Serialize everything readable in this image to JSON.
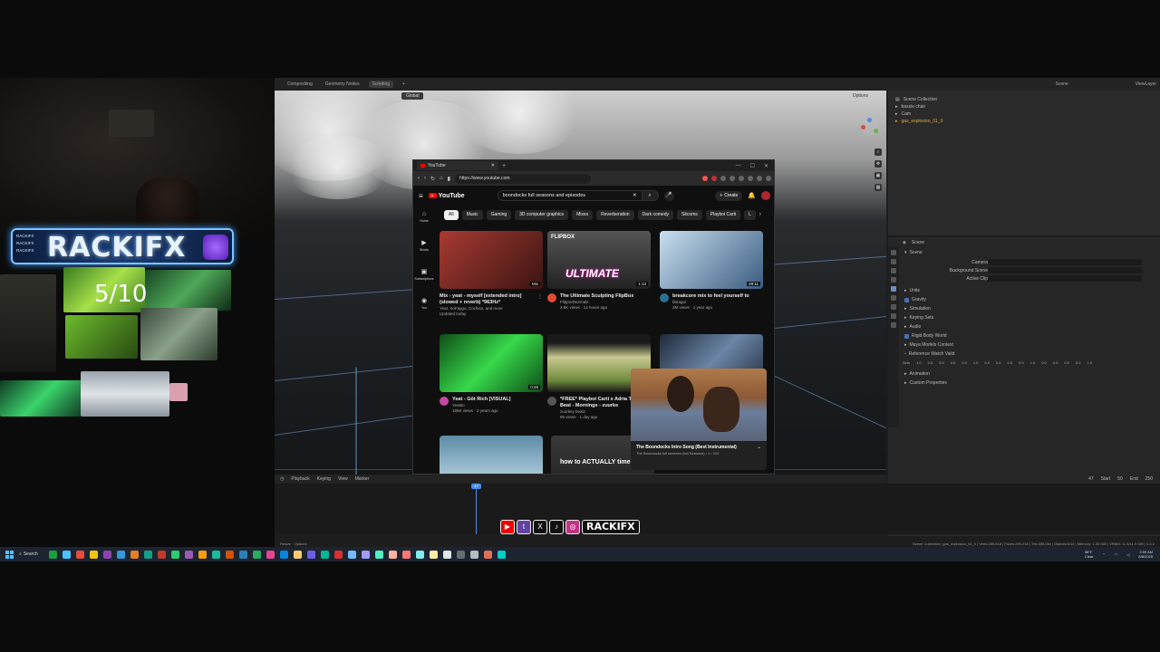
{
  "blender": {
    "workspace_tabs": [
      "Compositing",
      "Geometry Nodes",
      "Scripting",
      "+"
    ],
    "active_workspace": "Scripting",
    "viewport_mode": "Global",
    "options_label": "Options",
    "scene_label": "Scene",
    "view_layer_label": "ViewLayer",
    "outliner": {
      "rows": [
        "Scene Collection",
        "bassie chair",
        "Cam",
        "gas_explosion_01_0"
      ]
    },
    "properties": {
      "header": "Scene",
      "section_scene": "Scene",
      "fields": [
        {
          "label": "Camera"
        },
        {
          "label": "Background Scene"
        },
        {
          "label": "Active Clip"
        }
      ],
      "sections": [
        "Units",
        "Gravity",
        "Simulation",
        "Keying Sets",
        "Audio",
        "Rigid Body World",
        "Maya Models Context",
        "Reference Watch Valid",
        "Animation",
        "Custom Properties"
      ],
      "numbers": [
        "Sets",
        "1.0",
        "0.0",
        "0.0",
        "0.0",
        "0.0",
        "1.0",
        "0.0",
        "0.0",
        "0.0",
        "0.0",
        "1.0",
        "0.0",
        "0.0",
        "0.0",
        "0.0",
        "1.0"
      ]
    },
    "timeline": {
      "menu": [
        "Playback",
        "Keying",
        "View",
        "Marker"
      ],
      "current_frame": "47",
      "start_label": "Start",
      "start": "50",
      "end_label": "End",
      "end": "250"
    },
    "status_left": [
      "Resize",
      "Options"
    ],
    "status_right": "Scene Collection | gas_explosion_01_0 | Verts:285,518 | Faces:299,218 | Tris:555,06x | Objects:0/14 | Memory: 1.33 GiB | VRAM: 11.4/11.9 GiB | 4.3.2"
  },
  "browser": {
    "tab_title": "YouTube",
    "url": "https://www.youtube.com",
    "window_controls": [
      "—",
      "☐",
      "✕"
    ],
    "search_query": "boondocks full seasons and episodes",
    "create_label": "Create",
    "side_nav": [
      {
        "icon": "⌂",
        "label": "Home"
      },
      {
        "icon": "▶",
        "label": "Shorts"
      },
      {
        "icon": "▣",
        "label": "Subscriptions"
      },
      {
        "icon": "◉",
        "label": "You"
      }
    ],
    "chips": [
      "All",
      "Music",
      "Gaming",
      "3D computer graphics",
      "Mixes",
      "Reverberation",
      "Dark comedy",
      "Sitcoms",
      "Playboi Carti",
      "L"
    ],
    "videos": [
      {
        "title": "Mix - yeat - myself [extended intro] (slowed + reverb) *963Hz*",
        "meta1": "Yeat, SoFaygo, Cochise, and more",
        "meta2": "Updated today",
        "duration": "Mix",
        "thumb": "#6d2a26",
        "avatar": ""
      },
      {
        "title": "The Ultimate Sculpting FlipBox",
        "meta1": "FlippedNormals",
        "meta2": "2.8K views · 14 hours ago",
        "duration": "1:13",
        "thumb": "#3d3d3d",
        "avatar": "#e24a3a",
        "overlay": "ULTIMATE",
        "brand": "FLIPBOX"
      },
      {
        "title": "breakcore mix to feel yourself to",
        "meta1": "bbragui",
        "meta2": "2M views · 1 year ago",
        "duration": "29:11",
        "thumb": "#8fb4d6",
        "avatar": "#2a6f8f"
      },
      {
        "title": "Yeat - Gōt Rich [VISUAL]",
        "meta1": "Yeatito",
        "meta2": "185K views · 2 years ago",
        "duration": "0:28",
        "thumb": "#1d8a2a",
        "avatar": "#c44aa0"
      },
      {
        "title": "*FREE* Playboi Carti x Adria Type Beat - Mornings - zuurke",
        "meta1": "zuurkey beatz",
        "meta2": "96 views · 1 day ago",
        "duration": "",
        "thumb": "#7d8a55",
        "avatar": "#555555"
      },
      {
        "title": "",
        "meta1": "",
        "meta2": "",
        "duration": "",
        "thumb": "#314257",
        "avatar": ""
      },
      {
        "title": "",
        "meta1": "",
        "meta2": "",
        "duration": "",
        "thumb": "#8fb0c4",
        "avatar": ""
      },
      {
        "title": "how to ACTUALLY time r",
        "meta1": "",
        "meta2": "",
        "duration": "",
        "thumb": "#2b2b2b",
        "avatar": ""
      }
    ],
    "miniplayer": {
      "title": "The Boondocks Intro Song (Best Instrumental)",
      "subtitle": "The Boondocks full seasons (full Seasons) • 1 / 102"
    }
  },
  "overlay": {
    "badge_name": "RACKIFX",
    "badge_list": [
      "RACKIFX",
      "RACKIFX",
      "RACKIFX"
    ],
    "rating": "5/10",
    "social_name": "RACKIFX",
    "social_icons": [
      "▶",
      "t",
      "X",
      "♪",
      "◎"
    ]
  },
  "taskbar": {
    "search_label": "Search",
    "weather_temp": "58°F",
    "weather_desc": "Clear",
    "time": "2:59 AM",
    "date": "8/8/2025",
    "icon_colors": [
      "#1b9e3e",
      "#4cc2ff",
      "#e74c3c",
      "#f1c40f",
      "#8e44ad",
      "#3498db",
      "#e67e22",
      "#16a085",
      "#c0392b",
      "#2ecc71",
      "#9b59b6",
      "#f39c12",
      "#1abc9c",
      "#d35400",
      "#2980b9",
      "#27ae60",
      "#e84393",
      "#0984e3",
      "#fdcb6e",
      "#6c5ce7",
      "#00b894",
      "#d63031",
      "#74b9ff",
      "#a29bfe",
      "#55efc4",
      "#fab1a0",
      "#ff7675",
      "#81ecec",
      "#ffeaa7",
      "#dfe6e9",
      "#636e72",
      "#b2bec3",
      "#e17055",
      "#00cec9"
    ]
  }
}
